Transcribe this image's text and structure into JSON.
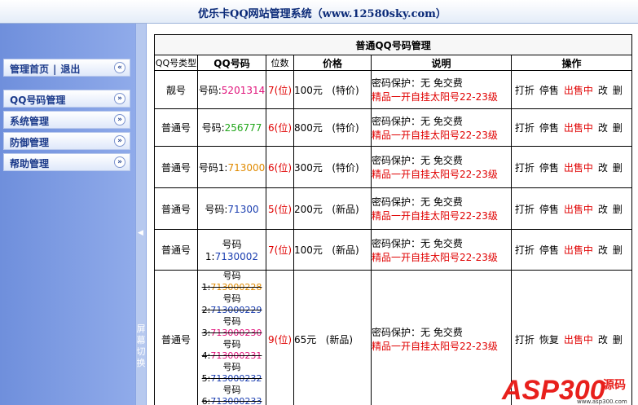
{
  "header": {
    "title": "优乐卡QQ网站管理系统（www.12580sky.com）"
  },
  "sidebar": {
    "top": {
      "home": "管理首页",
      "sep": "|",
      "logout": "退出"
    },
    "items": [
      {
        "label": "QQ号码管理"
      },
      {
        "label": "系统管理"
      },
      {
        "label": "防御管理"
      },
      {
        "label": "帮助管理"
      }
    ]
  },
  "switch": {
    "label": "屏幕切换"
  },
  "table": {
    "caption": "普通QQ号码管理",
    "columns": [
      "QQ号类型",
      "QQ号码",
      "位数",
      "价格",
      "说明",
      "操作"
    ],
    "rows": [
      {
        "type": "靓号",
        "prefix": "号码:",
        "number": "5201314",
        "ncolor": "pink",
        "digits": "7(位)",
        "price": "100元",
        "tag": "(特价)",
        "desc1": "密码保护：无 免交费",
        "desc2": "精品一开自挂太阳号22-23级",
        "actions": [
          "打折",
          "停售",
          "出售中",
          "改",
          "删"
        ]
      },
      {
        "type": "普通号",
        "prefix": "号码:",
        "number": "256777",
        "ncolor": "green",
        "digits": "6(位)",
        "price": "800元",
        "tag": "(特价)",
        "desc1": "密码保护：无 免交费",
        "desc2": "精品一开自挂太阳号22-23级",
        "actions": [
          "打折",
          "停售",
          "出售中",
          "改",
          "删"
        ]
      },
      {
        "type": "普通号",
        "prefix": "号码1:",
        "number": "713000",
        "ncolor": "orange",
        "digits": "6(位)",
        "price": "300元",
        "tag": "(特价)",
        "desc1": "密码保护：无 免交费",
        "desc2": "精品一开自挂太阳号22-23级",
        "actions": [
          "打折",
          "停售",
          "出售中",
          "改",
          "删"
        ]
      },
      {
        "type": "普通号",
        "prefix": "号码:",
        "number": "71300",
        "ncolor": "blue",
        "digits": "5(位)",
        "price": "200元",
        "tag": "(新品)",
        "desc1": "密码保护：无 免交费",
        "desc2": "精品一开自挂太阳号22-23级",
        "actions": [
          "打折",
          "停售",
          "出售中",
          "改",
          "删"
        ]
      },
      {
        "type": "普通号",
        "prefix": "号码1:",
        "number": "7130002",
        "ncolor": "blue",
        "digits": "7(位)",
        "price": "100元",
        "tag": "(新品)",
        "desc1": "密码保护：无 免交费",
        "desc2": "精品一开自挂太阳号22-23级",
        "actions": [
          "打折",
          "停售",
          "出售中",
          "改",
          "删"
        ]
      }
    ],
    "multi_row": {
      "type": "普通号",
      "entries": [
        {
          "label": "号码",
          "idx": "1:",
          "number": "713000228",
          "ncolor": "#e08a00"
        },
        {
          "label": "号码",
          "idx": "2:",
          "number": "713000229",
          "ncolor": "#1c3fb0"
        },
        {
          "label": "号码",
          "idx": "3:",
          "number": "713000230",
          "ncolor": "#e0127a"
        },
        {
          "label": "号码",
          "idx": "4:",
          "number": "713000231",
          "ncolor": "#e0127a"
        },
        {
          "label": "号码",
          "idx": "5:",
          "number": "713000232",
          "ncolor": "#1c3fb0"
        },
        {
          "label": "号码",
          "idx": "6:",
          "number": "713000233",
          "ncolor": "#1c3fb0"
        }
      ],
      "digits": "9(位)",
      "price": "65元",
      "tag": "(新品)",
      "desc1": "密码保护：无 免交费",
      "desc2": "精品一开自挂太阳号22-23级",
      "actions": [
        "打折",
        "恢复",
        "出售中",
        "改",
        "删"
      ]
    }
  },
  "watermark": {
    "text": "ASP300",
    "sub": "源码",
    "domain": "www.asp300.com"
  }
}
